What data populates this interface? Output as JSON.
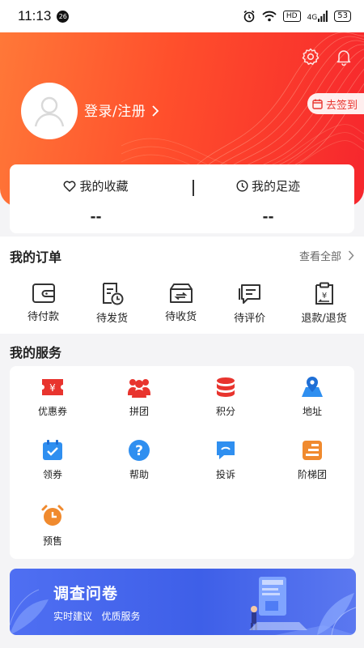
{
  "status_bar": {
    "time": "11:13",
    "badge": "26",
    "hd_label": "HD",
    "network": "4G",
    "battery": "53"
  },
  "header": {
    "login_label": "登录/注册",
    "signin_label": "去签到",
    "icons": [
      "settings-icon",
      "bell-icon"
    ]
  },
  "favorites_card": {
    "favorites_label": "我的收藏",
    "favorites_value": "--",
    "history_label": "我的足迹",
    "history_value": "--"
  },
  "orders": {
    "title": "我的订单",
    "view_all": "查看全部",
    "items": [
      {
        "label": "待付款",
        "icon": "wallet-icon"
      },
      {
        "label": "待发货",
        "icon": "clock-document-icon"
      },
      {
        "label": "待收货",
        "icon": "box-icon"
      },
      {
        "label": "待评价",
        "icon": "comment-icon"
      },
      {
        "label": "退款/退货",
        "icon": "refund-icon"
      }
    ]
  },
  "services": {
    "title": "我的服务",
    "items": [
      {
        "label": "优惠券",
        "icon": "coupon-icon"
      },
      {
        "label": "拼团",
        "icon": "group-icon"
      },
      {
        "label": "积分",
        "icon": "points-icon"
      },
      {
        "label": "地址",
        "icon": "location-icon"
      },
      {
        "label": "领券",
        "icon": "calendar-check-icon"
      },
      {
        "label": "帮助",
        "icon": "help-icon"
      },
      {
        "label": "投诉",
        "icon": "complaint-icon"
      },
      {
        "label": "阶梯团",
        "icon": "ladder-icon"
      },
      {
        "label": "预售",
        "icon": "alarm-icon"
      }
    ]
  },
  "banner": {
    "title": "调查问卷",
    "subtitle_1": "实时建议",
    "subtitle_2": "优质服务"
  },
  "colors": {
    "brand_red": "#f6262d",
    "brand_orange": "#ff7838",
    "service_red": "#e8342e",
    "service_blue": "#2f8ff0",
    "service_orange": "#f08a2e",
    "banner_blue": "#4563ec"
  }
}
